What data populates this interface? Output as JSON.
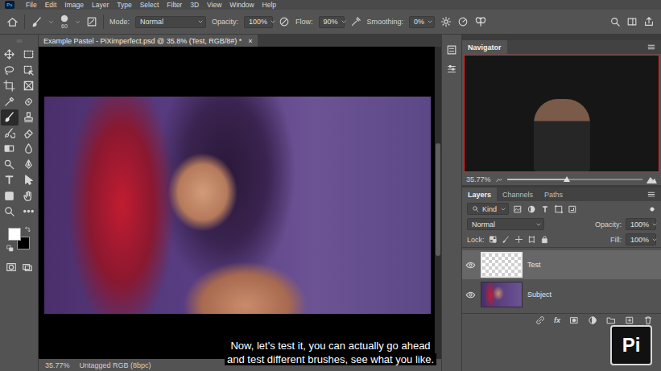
{
  "app": {
    "logo": "Ps"
  },
  "menu": [
    "File",
    "Edit",
    "Image",
    "Layer",
    "Type",
    "Select",
    "Filter",
    "3D",
    "View",
    "Window",
    "Help"
  ],
  "options_bar": {
    "brush_size": "60",
    "mode_label": "Mode:",
    "mode": "Normal",
    "opacity_label": "Opacity:",
    "opacity": "100%",
    "flow_label": "Flow:",
    "flow": "90%",
    "smoothing_label": "Smoothing:",
    "smoothing": "0%"
  },
  "toolbar": {
    "tools": [
      {
        "selected": false
      },
      {
        "selected": false
      },
      {
        "selected": false
      },
      {
        "selected": false
      },
      {
        "selected": false
      },
      {
        "selected": false
      },
      {
        "selected": false
      },
      {
        "selected": false
      },
      {
        "selected": true
      },
      {
        "selected": false
      },
      {
        "selected": false
      },
      {
        "selected": false
      },
      {
        "selected": false
      },
      {
        "selected": false
      },
      {
        "selected": false
      },
      {
        "selected": false
      },
      {
        "selected": false
      },
      {
        "selected": false
      },
      {
        "selected": false
      },
      {
        "selected": false
      },
      {
        "selected": false
      },
      {
        "selected": false
      }
    ],
    "foreground_color": "#ffffff",
    "background_color": "#000000"
  },
  "document": {
    "tab_title": "Example Pastel - PiXimperfect.psd @ 35.8% (Test, RGB/8#) *",
    "close": "×"
  },
  "status_bar": {
    "zoom": "35.77%",
    "profile": "Untagged RGB (8bpc)"
  },
  "subtitle": {
    "lines": [
      "Now, let's test it, you can actually go ahead",
      "and test different brushes, see what you like."
    ]
  },
  "navigator": {
    "title": "Navigator",
    "zoom": "35.77%",
    "level": 0.44
  },
  "layers_panel": {
    "tabs": [
      {
        "label": "Layers",
        "selected": true
      },
      {
        "label": "Channels",
        "selected": false
      },
      {
        "label": "Paths",
        "selected": false
      }
    ],
    "filter": "Kind",
    "blend_mode": "Normal",
    "opacity_label": "Opacity:",
    "opacity": "100%",
    "lock_label": "Lock:",
    "fill_label": "Fill:",
    "fill": "100%",
    "layers": [
      {
        "name": "Test",
        "selected": true,
        "visible": true,
        "kind": "empty"
      },
      {
        "name": "Subject",
        "selected": false,
        "visible": true,
        "kind": "photo"
      }
    ],
    "footer_fx": "fx"
  },
  "watermark": {
    "logo": "Pi"
  }
}
